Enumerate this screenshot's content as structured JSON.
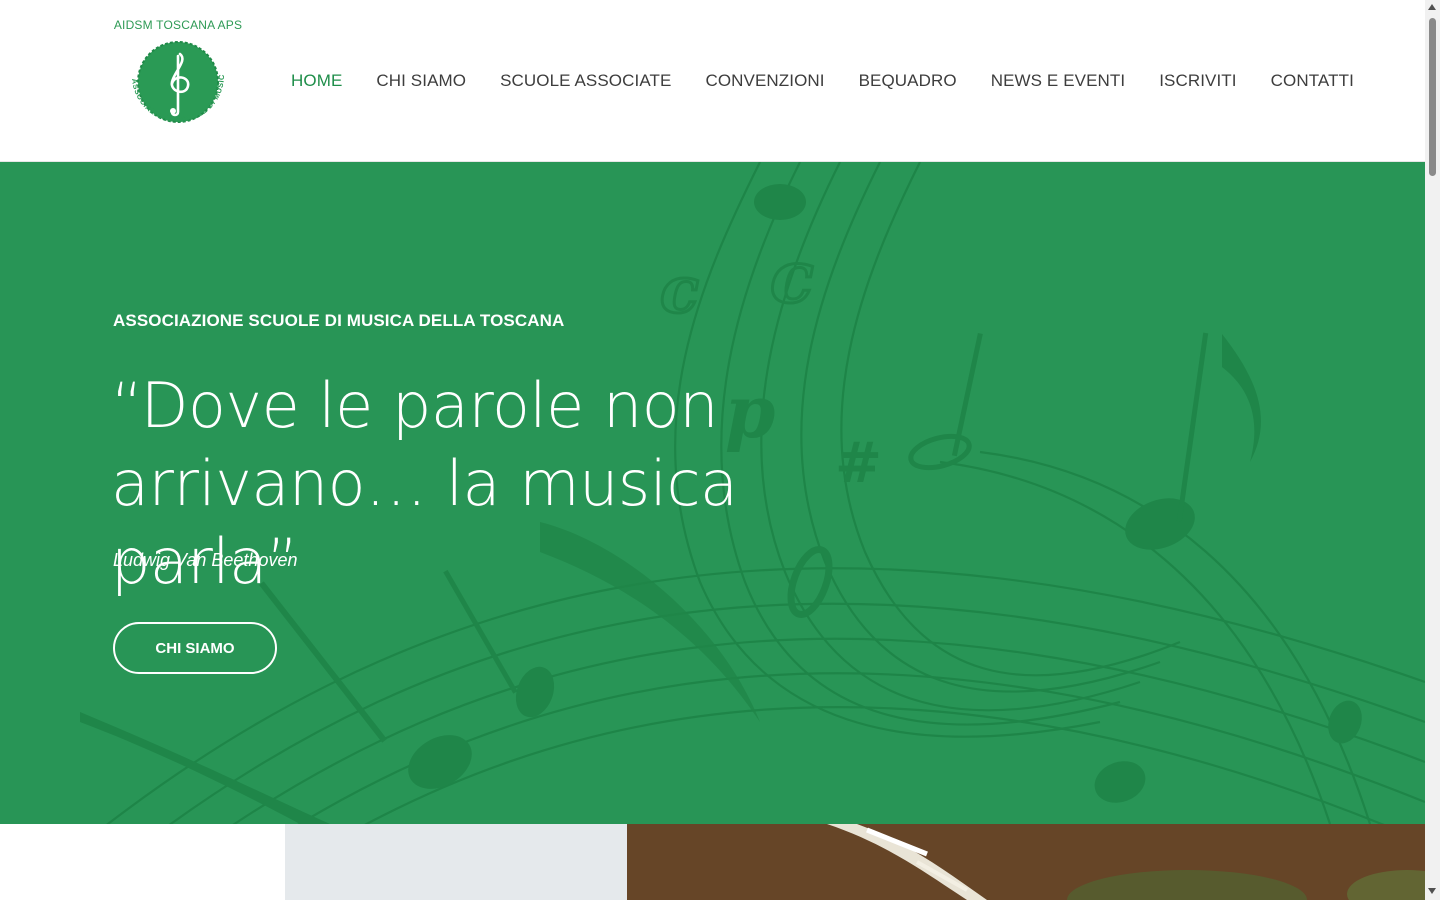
{
  "logo": {
    "top_text": "AIDSM TOSCANA APS",
    "ring_text": "ASSOCIAZIONE SCUOLE DI MUSICA TOSCANA",
    "icon": "treble-clef-icon"
  },
  "nav": {
    "items": [
      {
        "label": "HOME",
        "active": true
      },
      {
        "label": "CHI SIAMO",
        "active": false
      },
      {
        "label": "SCUOLE ASSOCIATE",
        "active": false
      },
      {
        "label": "CONVENZIONI",
        "active": false
      },
      {
        "label": "BEQUADRO",
        "active": false
      },
      {
        "label": "NEWS E EVENTI",
        "active": false
      },
      {
        "label": "ISCRIVITI",
        "active": false
      },
      {
        "label": "CONTATTI",
        "active": false
      }
    ]
  },
  "hero": {
    "eyebrow": "ASSOCIAZIONE SCUOLE DI MUSICA DELLA TOSCANA",
    "quote_line1": "“Dove le parole non",
    "quote_line2": "arrivano… la musica parla”",
    "author": "Ludwig Van Beethoven",
    "cta_label": "CHI SIAMO"
  },
  "colors": {
    "brand_green": "#289556",
    "nav_active": "#1f8e4a",
    "nav_text": "#3d3d3d"
  }
}
